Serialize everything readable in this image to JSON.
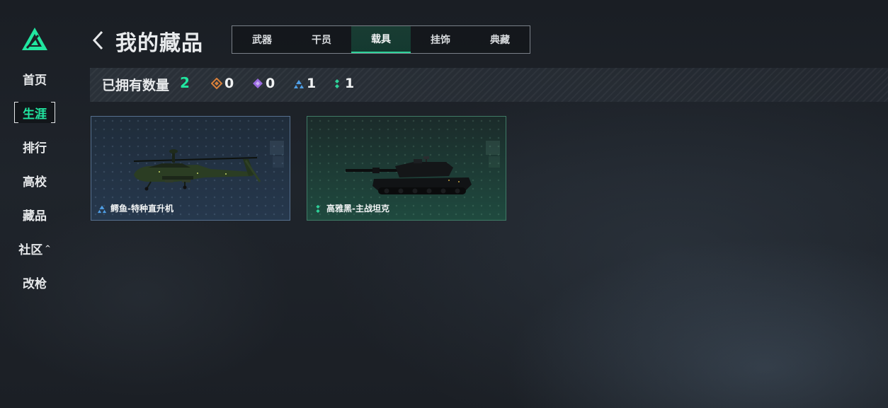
{
  "sidebar": {
    "items": [
      {
        "label": "首页",
        "active": false
      },
      {
        "label": "生涯",
        "active": true
      },
      {
        "label": "排行",
        "active": false
      },
      {
        "label": "高校",
        "active": false
      },
      {
        "label": "藏品",
        "active": false
      },
      {
        "label": "社区",
        "active": false,
        "caret": "^"
      },
      {
        "label": "改枪",
        "active": false
      }
    ]
  },
  "header": {
    "title": "我的藏品",
    "back_icon": "chevron-left-icon"
  },
  "tabs": [
    {
      "label": "武器",
      "active": false
    },
    {
      "label": "干员",
      "active": false
    },
    {
      "label": "载具",
      "active": true
    },
    {
      "label": "挂饰",
      "active": false
    },
    {
      "label": "典藏",
      "active": false
    }
  ],
  "summary": {
    "owned_label": "已拥有数量",
    "owned_count": "2",
    "rarities": [
      {
        "icon": "orange-diamond-icon",
        "color": "#d8803a",
        "count": "0"
      },
      {
        "icon": "purple-diamond-icon",
        "color": "#9a6ae0",
        "count": "0"
      },
      {
        "icon": "blue-triangle-icon",
        "color": "#4f9fe6",
        "count": "1"
      },
      {
        "icon": "green-dots-icon",
        "color": "#2ed39a",
        "count": "1"
      }
    ]
  },
  "cards": [
    {
      "name": "鳄鱼-特种直升机",
      "rarity_icon": "blue-triangle-icon",
      "theme": "blue"
    },
    {
      "name": "高雅黑-主战坦克",
      "rarity_icon": "green-dots-icon",
      "theme": "green"
    }
  ],
  "colors": {
    "accent": "#21e6a0",
    "tab_active_border": "#2ed39a"
  }
}
